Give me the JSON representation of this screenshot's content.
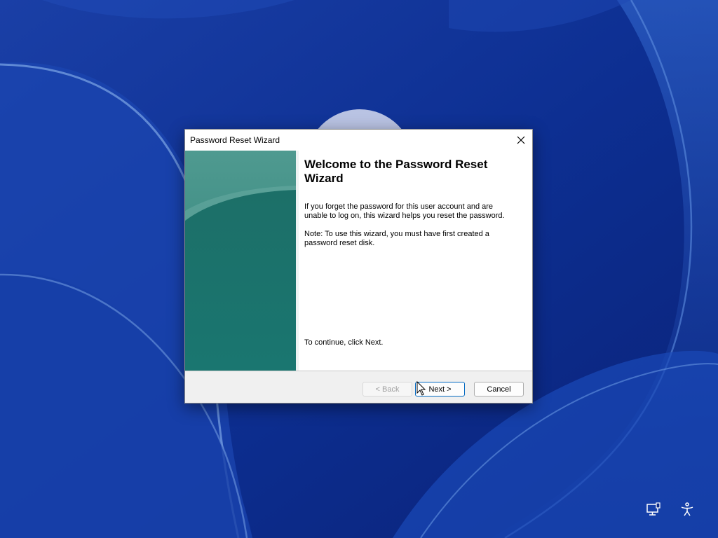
{
  "dialog": {
    "title": "Password Reset Wizard",
    "heading": "Welcome to the Password Reset Wizard",
    "paragraph1": "If you forget the password for this user account and are unable to log on, this wizard helps you reset the password.",
    "paragraph2": "Note: To use this wizard, you must have first created a password reset disk.",
    "paragraph3": "To continue, click Next.",
    "buttons": {
      "back": "< Back",
      "next": "Next >",
      "cancel": "Cancel"
    },
    "back_enabled": false
  },
  "tray": {
    "icons": [
      "network-icon",
      "accessibility-icon"
    ]
  },
  "colors": {
    "desktop_bg": "#0c2a8a",
    "side_panel": "#1f7a73",
    "focus_border": "#0067c0"
  }
}
